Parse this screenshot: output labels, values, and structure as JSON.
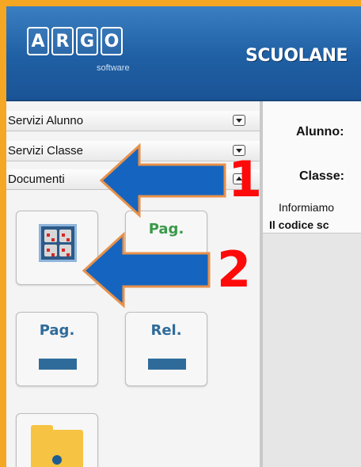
{
  "header": {
    "logo_letters": [
      "A",
      "R",
      "G",
      "O"
    ],
    "logo_sub": "software",
    "app_title": "SCUOLANE"
  },
  "sidebar": {
    "menus": [
      {
        "label": "Servizi Alunno",
        "state": "collapsed"
      },
      {
        "label": "Servizi Classe",
        "state": "collapsed"
      },
      {
        "label": "Documenti",
        "state": "expanded"
      }
    ],
    "tiles": [
      {
        "caption": "",
        "icon": "bulletin-board-icon"
      },
      {
        "caption": "Pag.",
        "icon": "pagella-icon"
      },
      {
        "caption": "Pag.",
        "icon": "pagella-icon"
      },
      {
        "caption": "Rel.",
        "icon": "relazione-icon"
      },
      {
        "caption": "",
        "icon": "folder-lock-icon"
      }
    ]
  },
  "main": {
    "alunno_label": "Alunno:",
    "classe_label": "Classe:",
    "info_text": "Informiamo",
    "codice_text": "Il codice sc"
  },
  "annotations": {
    "step1": "1",
    "step2": "2",
    "arrow_color": "#1565c0",
    "number_color": "#ff0a0a"
  },
  "colors": {
    "frame": "#f5a623",
    "header": "#1f5fa3",
    "pag_green": "#3a9a4a",
    "rel_blue": "#2f6b9a"
  }
}
